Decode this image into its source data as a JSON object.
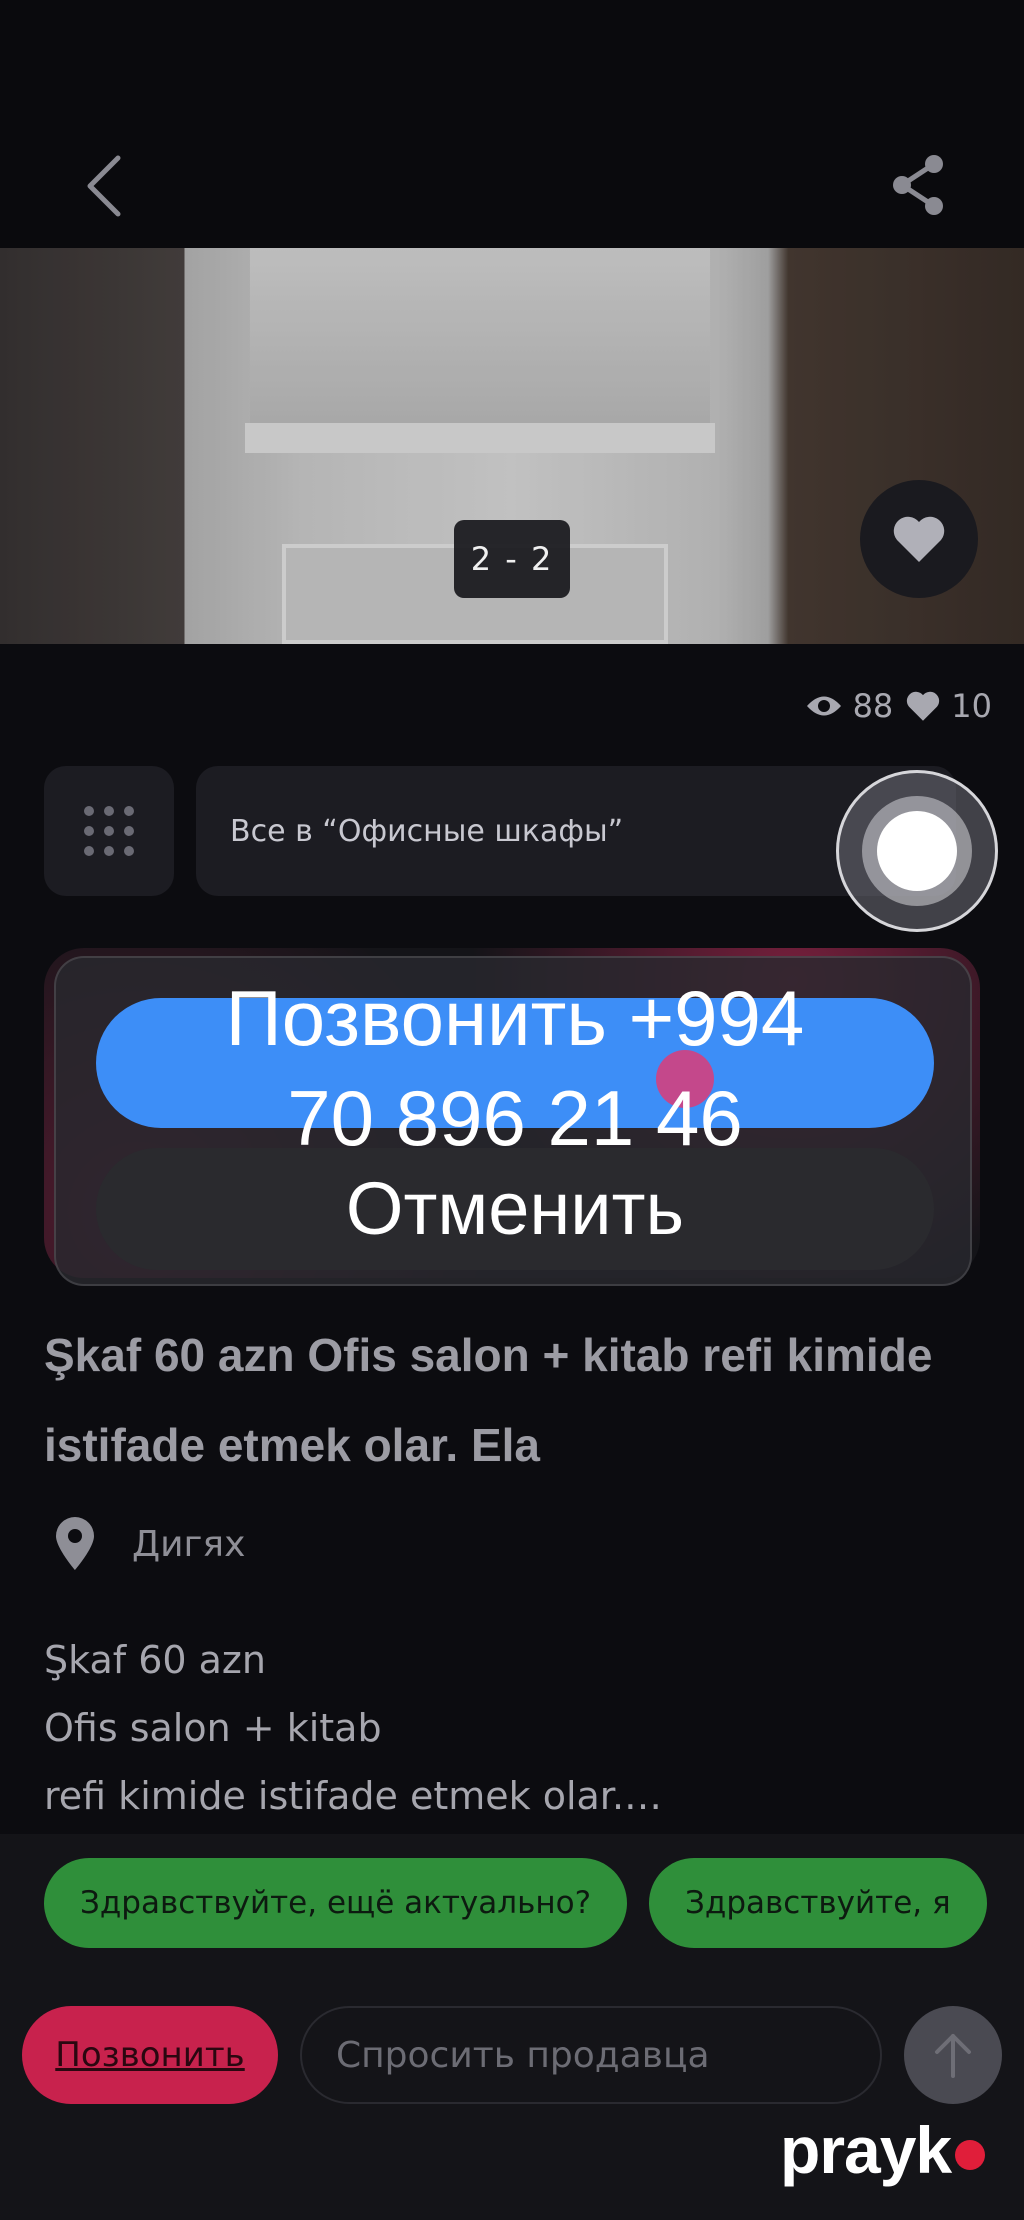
{
  "gallery": {
    "counter": "2 - 2"
  },
  "stats": {
    "views": "88",
    "likes": "10"
  },
  "category": {
    "label": "Все в “Офисные шкафы”"
  },
  "call_dialog": {
    "call_label": "Позвонить +994\n70 896 21 46",
    "cancel_label": "Отменить"
  },
  "listing": {
    "title": "Şkaf 60 azn Ofis salon + kitab refi kimide istifade etmek olar. Ela",
    "location": "Дигях",
    "description": "Şkaf 60 azn\nOfis salon + kitab\nrefi kimide istifade etmek olar.…"
  },
  "quick_replies": [
    "Здравствуйте, ещё актуально?",
    "Здравствуйте, я"
  ],
  "bottom_bar": {
    "call_button": "Позвонить",
    "ask_placeholder": "Спросить продавца"
  },
  "watermark": {
    "text": "prayk"
  },
  "colors": {
    "accent_red": "#c8224d",
    "dialog_blue": "#3d8ef7",
    "chip_green": "#2f8f3a"
  }
}
